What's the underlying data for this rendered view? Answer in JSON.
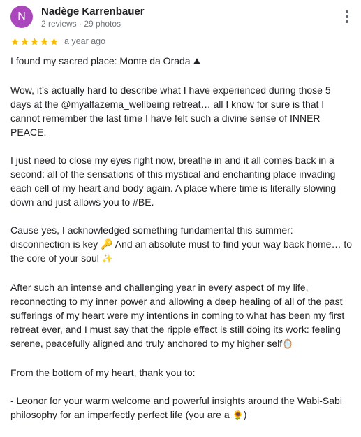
{
  "review": {
    "author": {
      "initial": "N",
      "name": "Nadège Karrenbauer",
      "meta": "2 reviews · 29 photos",
      "avatar_color": "#ab47bc"
    },
    "rating": {
      "stars": 5,
      "max": 5,
      "color": "#fbbc04"
    },
    "date": "a year ago",
    "menu_icon": "more-vert-icon",
    "paragraphs": [
      {
        "text": "I found my sacred place: Monte da Orada ",
        "emoji": "⛰"
      },
      {
        "text": "Wow, it’s actually hard to describe what I have experienced during those 5 days at the @myalfazema_wellbeing retreat… all I know for sure is that I cannot remember the last time I have felt such a divine sense of INNER PEACE.",
        "emoji": ""
      },
      {
        "text": "I just need to close my eyes right now, breathe in and it all comes back in a second: all of the sensations of this mystical and enchanting place invading each cell of my heart and body again. A place where time is literally slowing down and just allows you to #BE.",
        "emoji": ""
      },
      {
        "text": "Cause yes, I acknowledged something fundamental this summer: disconnection is key 🔑 And an absolute must to find your way back home… to the core of your soul ",
        "emoji": "✨"
      },
      {
        "text": "After such an intense and challenging year in every aspect of my life, reconnecting to my inner power and allowing a deep healing of all of the past sufferings of my heart were my intentions in coming to what has been my first retreat ever, and I must say that the ripple effect is still doing its work: feeling serene, peacefully aligned and truly anchored to my higher self",
        "emoji": "🪞"
      },
      {
        "text": "From the bottom of my heart, thank you to:",
        "emoji": ""
      },
      {
        "text": "- Leonor for your warm welcome and powerful insights around the Wabi-Sabi philosophy for an imperfectly perfect life (you are a ",
        "emoji": "🌻)"
      }
    ]
  }
}
